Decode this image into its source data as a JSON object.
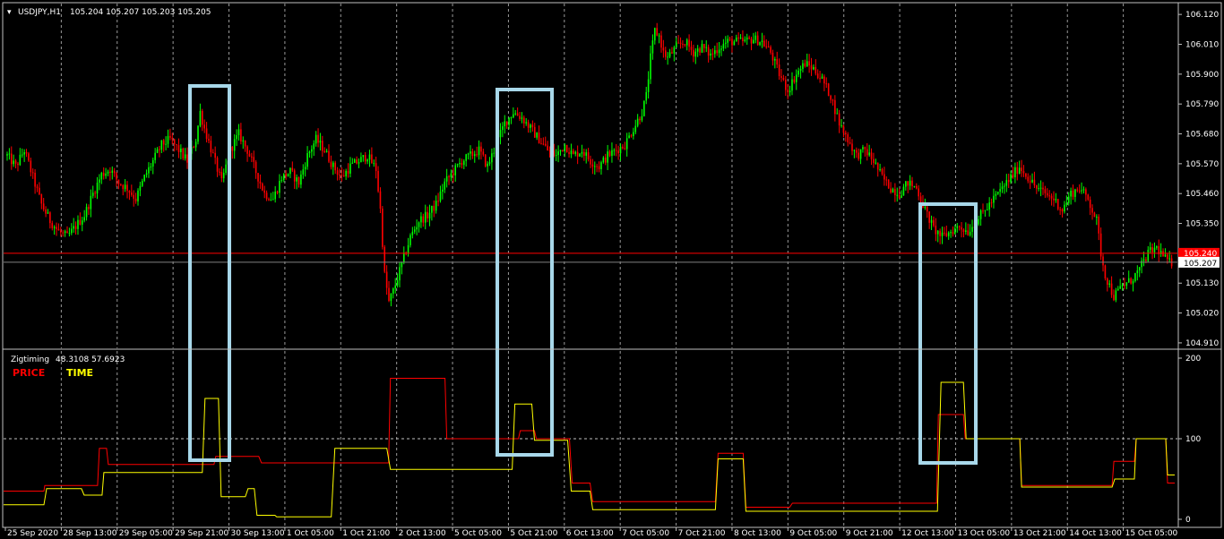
{
  "chart_data": [
    {
      "type": "candlestick",
      "symbol_title": "USDJPY,H1",
      "ohlc_header": "105.204 105.207 105.203 105.205",
      "price_axis": {
        "ticks": [
          "106.120",
          "106.010",
          "105.900",
          "105.790",
          "105.680",
          "105.570",
          "105.460",
          "105.350",
          "105.240",
          "105.130",
          "105.020",
          "104.910"
        ],
        "range": [
          104.89,
          106.16
        ]
      },
      "current_price": "105.207",
      "red_line_price": "105.240",
      "x_tick_labels": [
        "25 Sep 2020",
        "28 Sep 13:00",
        "29 Sep 05:00",
        "29 Sep 21:00",
        "30 Sep 13:00",
        "1 Oct 05:00",
        "1 Oct 21:00",
        "2 Oct 13:00",
        "5 Oct 05:00",
        "5 Oct 21:00",
        "6 Oct 13:00",
        "7 Oct 05:00",
        "7 Oct 21:00",
        "8 Oct 13:00",
        "9 Oct 05:00",
        "9 Oct 21:00",
        "12 Oct 13:00",
        "13 Oct 05:00",
        "13 Oct 21:00",
        "14 Oct 13:00",
        "15 Oct 05:00"
      ],
      "close_path": [
        [
          0,
          105.6
        ],
        [
          4,
          105.56
        ],
        [
          8,
          105.62
        ],
        [
          12,
          105.52
        ],
        [
          16,
          105.42
        ],
        [
          20,
          105.36
        ],
        [
          24,
          105.32
        ],
        [
          28,
          105.3
        ],
        [
          32,
          105.34
        ],
        [
          36,
          105.38
        ],
        [
          40,
          105.46
        ],
        [
          44,
          105.53
        ],
        [
          48,
          105.55
        ],
        [
          52,
          105.5
        ],
        [
          56,
          105.48
        ],
        [
          60,
          105.44
        ],
        [
          64,
          105.52
        ],
        [
          68,
          105.58
        ],
        [
          72,
          105.64
        ],
        [
          76,
          105.66
        ],
        [
          80,
          105.62
        ],
        [
          84,
          105.58
        ],
        [
          88,
          105.66
        ],
        [
          90,
          105.76
        ],
        [
          92,
          105.7
        ],
        [
          96,
          105.6
        ],
        [
          100,
          105.5
        ],
        [
          104,
          105.62
        ],
        [
          108,
          105.68
        ],
        [
          112,
          105.62
        ],
        [
          116,
          105.54
        ],
        [
          120,
          105.46
        ],
        [
          124,
          105.44
        ],
        [
          128,
          105.52
        ],
        [
          132,
          105.54
        ],
        [
          136,
          105.5
        ],
        [
          140,
          105.6
        ],
        [
          144,
          105.66
        ],
        [
          148,
          105.62
        ],
        [
          152,
          105.56
        ],
        [
          156,
          105.52
        ],
        [
          160,
          105.56
        ],
        [
          164,
          105.58
        ],
        [
          168,
          105.6
        ],
        [
          172,
          105.55
        ],
        [
          174,
          105.4
        ],
        [
          176,
          105.16
        ],
        [
          178,
          105.06
        ],
        [
          180,
          105.1
        ],
        [
          184,
          105.2
        ],
        [
          188,
          105.3
        ],
        [
          192,
          105.36
        ],
        [
          196,
          105.38
        ],
        [
          200,
          105.42
        ],
        [
          204,
          105.5
        ],
        [
          208,
          105.54
        ],
        [
          212,
          105.58
        ],
        [
          216,
          105.6
        ],
        [
          220,
          105.62
        ],
        [
          224,
          105.56
        ],
        [
          228,
          105.64
        ],
        [
          232,
          105.72
        ],
        [
          236,
          105.76
        ],
        [
          240,
          105.74
        ],
        [
          244,
          105.7
        ],
        [
          248,
          105.66
        ],
        [
          252,
          105.62
        ],
        [
          256,
          105.6
        ],
        [
          260,
          105.64
        ],
        [
          264,
          105.6
        ],
        [
          268,
          105.62
        ],
        [
          272,
          105.58
        ],
        [
          276,
          105.56
        ],
        [
          280,
          105.6
        ],
        [
          284,
          105.62
        ],
        [
          288,
          105.64
        ],
        [
          292,
          105.7
        ],
        [
          296,
          105.76
        ],
        [
          298,
          105.82
        ],
        [
          300,
          105.96
        ],
        [
          302,
          106.06
        ],
        [
          304,
          106.04
        ],
        [
          306,
          105.98
        ],
        [
          308,
          105.96
        ],
        [
          312,
          106.0
        ],
        [
          316,
          106.02
        ],
        [
          320,
          105.98
        ],
        [
          324,
          106.0
        ],
        [
          328,
          105.97
        ],
        [
          332,
          106.0
        ],
        [
          336,
          106.02
        ],
        [
          340,
          106.02
        ],
        [
          344,
          106.02
        ],
        [
          348,
          106.03
        ],
        [
          352,
          106.02
        ],
        [
          356,
          105.98
        ],
        [
          360,
          105.9
        ],
        [
          364,
          105.84
        ],
        [
          368,
          105.9
        ],
        [
          372,
          105.94
        ],
        [
          376,
          105.92
        ],
        [
          380,
          105.88
        ],
        [
          384,
          105.82
        ],
        [
          388,
          105.72
        ],
        [
          392,
          105.66
        ],
        [
          396,
          105.6
        ],
        [
          400,
          105.62
        ],
        [
          404,
          105.58
        ],
        [
          408,
          105.52
        ],
        [
          412,
          105.48
        ],
        [
          416,
          105.46
        ],
        [
          420,
          105.5
        ],
        [
          424,
          105.48
        ],
        [
          428,
          105.4
        ],
        [
          432,
          105.33
        ],
        [
          436,
          105.3
        ],
        [
          440,
          105.32
        ],
        [
          444,
          105.34
        ],
        [
          448,
          105.32
        ],
        [
          452,
          105.36
        ],
        [
          456,
          105.4
        ],
        [
          460,
          105.44
        ],
        [
          464,
          105.48
        ],
        [
          468,
          105.52
        ],
        [
          472,
          105.56
        ],
        [
          476,
          105.52
        ],
        [
          480,
          105.48
        ],
        [
          484,
          105.46
        ],
        [
          488,
          105.44
        ],
        [
          492,
          105.4
        ],
        [
          496,
          105.46
        ],
        [
          500,
          105.48
        ],
        [
          504,
          105.44
        ],
        [
          508,
          105.36
        ],
        [
          510,
          105.24
        ],
        [
          512,
          105.16
        ],
        [
          514,
          105.12
        ],
        [
          516,
          105.08
        ],
        [
          520,
          105.12
        ],
        [
          524,
          105.14
        ],
        [
          528,
          105.18
        ],
        [
          532,
          105.24
        ],
        [
          536,
          105.26
        ],
        [
          540,
          105.22
        ],
        [
          542,
          105.205
        ]
      ]
    },
    {
      "type": "line",
      "indicator_name": "Zigtiming",
      "indicator_values": "48.3108 57.6923",
      "legend": [
        {
          "name": "PRICE",
          "color": "#ff0000"
        },
        {
          "name": "TIME",
          "color": "#ffff00"
        }
      ],
      "y_ticks": [
        "200",
        "100",
        "0"
      ],
      "ylim": [
        0,
        200
      ],
      "series": [
        {
          "name": "PRICE",
          "color": "#ff0000",
          "points": [
            [
              0,
              35
            ],
            [
              45,
              35
            ],
            [
              46,
              42
            ],
            [
              105,
              42
            ],
            [
              107,
              88
            ],
            [
              115,
              88
            ],
            [
              117,
              68
            ],
            [
              235,
              68
            ],
            [
              237,
              78
            ],
            [
              285,
              78
            ],
            [
              288,
              70
            ],
            [
              430,
              70
            ],
            [
              432,
              175
            ],
            [
              493,
              175
            ],
            [
              495,
              100
            ],
            [
              575,
              100
            ],
            [
              577,
              110
            ],
            [
              593,
              110
            ],
            [
              595,
              100
            ],
            [
              632,
              100
            ],
            [
              635,
              45
            ],
            [
              655,
              45
            ],
            [
              658,
              22
            ],
            [
              795,
              22
            ],
            [
              798,
              82
            ],
            [
              826,
              82
            ],
            [
              829,
              15
            ],
            [
              878,
              15
            ],
            [
              881,
              20
            ],
            [
              1042,
              20
            ],
            [
              1044,
              130
            ],
            [
              1072,
              130
            ],
            [
              1074,
              100
            ],
            [
              1135,
              100
            ],
            [
              1137,
              42
            ],
            [
              1238,
              42
            ],
            [
              1240,
              72
            ],
            [
              1263,
              72
            ],
            [
              1265,
              100
            ],
            [
              1298,
              100
            ],
            [
              1300,
              45
            ],
            [
              1308,
              45
            ]
          ]
        },
        {
          "name": "TIME",
          "color": "#ffff00",
          "points": [
            [
              0,
              18
            ],
            [
              45,
              18
            ],
            [
              48,
              38
            ],
            [
              87,
              38
            ],
            [
              90,
              30
            ],
            [
              110,
              30
            ],
            [
              112,
              58
            ],
            [
              222,
              58
            ],
            [
              225,
              150
            ],
            [
              240,
              150
            ],
            [
              243,
              28
            ],
            [
              270,
              28
            ],
            [
              273,
              38
            ],
            [
              280,
              38
            ],
            [
              283,
              5
            ],
            [
              303,
              5
            ],
            [
              305,
              3
            ],
            [
              366,
              3
            ],
            [
              370,
              88
            ],
            [
              428,
              88
            ],
            [
              432,
              62
            ],
            [
              568,
              62
            ],
            [
              571,
              143
            ],
            [
              590,
              143
            ],
            [
              593,
              98
            ],
            [
              630,
              98
            ],
            [
              634,
              35
            ],
            [
              655,
              35
            ],
            [
              658,
              12
            ],
            [
              795,
              12
            ],
            [
              798,
              75
            ],
            [
              826,
              75
            ],
            [
              829,
              10
            ],
            [
              1043,
              10
            ],
            [
              1047,
              170
            ],
            [
              1072,
              170
            ],
            [
              1075,
              100
            ],
            [
              1135,
              100
            ],
            [
              1137,
              40
            ],
            [
              1238,
              40
            ],
            [
              1241,
              50
            ],
            [
              1263,
              50
            ],
            [
              1265,
              100
            ],
            [
              1298,
              100
            ],
            [
              1300,
              55
            ],
            [
              1308,
              55
            ]
          ]
        }
      ],
      "x_range": [
        0,
        1311
      ]
    }
  ],
  "highlights": [
    {
      "x1": 212,
      "y1": 96,
      "x2": 256,
      "y2": 514
    },
    {
      "x1": 555,
      "y1": 100,
      "x2": 616,
      "y2": 508
    },
    {
      "x1": 1027,
      "y1": 228,
      "x2": 1089,
      "y2": 517
    }
  ],
  "colors": {
    "background": "#000000",
    "bull": "#00ff00",
    "bear": "#ff0000",
    "grid": "#c0c0c0",
    "highlight": "#a8d8ea",
    "price_label_bg": "#ffffff",
    "red_price_bg": "#ff0000"
  }
}
